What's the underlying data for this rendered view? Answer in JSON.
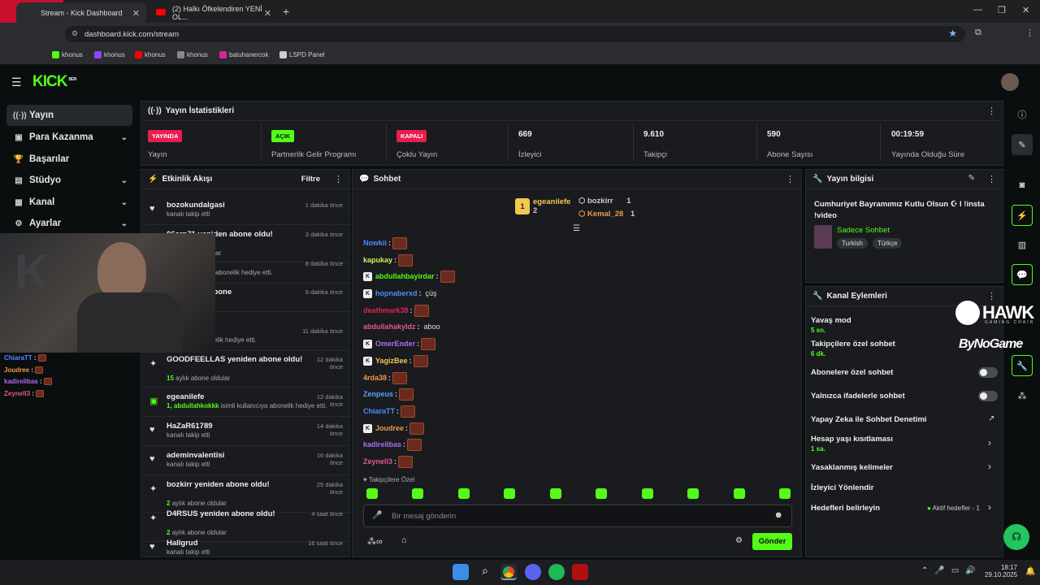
{
  "browser": {
    "tabs": [
      {
        "label": "Stream - Kick Dashboard",
        "active": true
      },
      {
        "label": "(2) Halkı Öfkelendiren YENİ OL...",
        "active": false
      }
    ],
    "url": "dashboard.kick.com/stream",
    "bookmarks": [
      "khonus",
      "khonus",
      "khonus",
      "khonus",
      "batuhanercok",
      "LSPD Panel"
    ]
  },
  "app": {
    "logo": "KICK",
    "logo_tag": "BETA"
  },
  "sidebar": {
    "items": [
      {
        "label": "Yayın",
        "icon": "broadcast-icon",
        "active": true
      },
      {
        "label": "Para Kazanma",
        "icon": "money-icon",
        "chev": true
      },
      {
        "label": "Başarılar",
        "icon": "trophy-icon"
      },
      {
        "label": "Stüdyo",
        "icon": "studio-icon",
        "chev": true
      },
      {
        "label": "Kanal",
        "icon": "channel-icon",
        "chev": true
      },
      {
        "label": "Ayarlar",
        "icon": "gear-icon",
        "chev": true
      }
    ]
  },
  "stats": {
    "title": "Yayın İstatistikleri",
    "items": [
      {
        "badge": "YAYINDA",
        "badge_color": "#e91e4e",
        "label": "Yayın"
      },
      {
        "badge": "AÇIK",
        "badge_color": "#53fc18",
        "label": "Partnerlik Gelir Programı"
      },
      {
        "badge": "KAPALI",
        "badge_color": "#e91e4e",
        "label": "Çoklu Yayın"
      },
      {
        "value": "669",
        "label": "İzleyici"
      },
      {
        "value": "9.610",
        "label": "Takipçi"
      },
      {
        "value": "590",
        "label": "Abone Sayısı"
      },
      {
        "value": "00:19:59",
        "label": "Yayında Olduğu Süre"
      }
    ]
  },
  "activity": {
    "title": "Etkinlik Akışı",
    "filter": "Filtre",
    "events": [
      {
        "name": "bozokundalgasi",
        "sub": "kanalı takip etti",
        "time": "1 dakika önce",
        "icon": "heart-icon"
      },
      {
        "name": "06ern71 yeniden abone oldu!",
        "sub": "aylık abone oldular",
        "time": "3 dakika önce",
        "icon": "sparkle-icon"
      },
      {
        "name": "",
        "sub": "isimli kullanıcıya abonelik hediye etti.",
        "time": "8 dakika önce",
        "icon": "gift-icon"
      },
      {
        "name": "da yeniden abone",
        "sub": "oldular",
        "time": "9 dakika önce",
        "icon": "sparkle-icon"
      },
      {
        "name": "",
        "sub": "kullanıcıya abonelik hediye etti.",
        "time": "11 dakika önce",
        "icon": "gift-icon"
      },
      {
        "name": "GOODFEELLAS yeniden abone oldu!",
        "sub_num": "15",
        "sub": "aylık abone oldular",
        "time": "12 dakika önce",
        "icon": "sparkle-icon"
      },
      {
        "name": "egeanilefe",
        "sub_num": "1, abdullahkokkk",
        "sub": "isimli kullanıcıya abonelik hediye etti.",
        "time": "12 dakika önce",
        "icon": "gift-icon"
      },
      {
        "name": "HaZaR61789",
        "sub": "kanalı takip etti",
        "time": "14 dakika önce",
        "icon": "heart-icon"
      },
      {
        "name": "ademinvalentisi",
        "sub": "kanalı takip etti",
        "time": "16 dakika önce",
        "icon": "heart-icon"
      },
      {
        "name": "bozkirr yeniden abone oldu!",
        "sub_num": "2",
        "sub": "aylık abone oldular",
        "time": "25 dakika önce",
        "icon": "sparkle-icon"
      },
      {
        "name": "D4RSUS yeniden abone oldu!",
        "sub_num": "2",
        "sub": "aylık abone oldular",
        "time": "4 saat önce",
        "icon": "sparkle-icon"
      },
      {
        "name": "Hallgrud",
        "sub": "kanalı takip etti",
        "time": "16 saat önce",
        "icon": "heart-icon"
      }
    ]
  },
  "chat": {
    "title": "Sohbet",
    "leaders": [
      {
        "name": "egeanilefe",
        "count": "2"
      },
      {
        "name": "bozkirr",
        "count": "1"
      },
      {
        "name": "Kemal_28",
        "count": "1"
      }
    ],
    "messages": [
      {
        "user": "Nowkii",
        "color": "#4e8cff",
        "text": ""
      },
      {
        "user": "kapukay",
        "color": "#c8f55a",
        "text": ""
      },
      {
        "user": "abdullahbayirdar",
        "color": "#53fc18",
        "text": ""
      },
      {
        "user": "hopnaberxd",
        "color": "#4e8cff",
        "text": "çüş"
      },
      {
        "user": "deathmark38",
        "color": "#e0234e",
        "text": ""
      },
      {
        "user": "abdullahakyldz",
        "color": "#e05a8a",
        "text": "aboo"
      },
      {
        "user": "OmerEnder",
        "color": "#b06cf5",
        "text": ""
      },
      {
        "user": "YagizBee",
        "color": "#f2c94c",
        "text": ""
      },
      {
        "user": "4rda38",
        "color": "#f2994a",
        "text": ""
      },
      {
        "user": "Zenpeus",
        "color": "#5aa0ff",
        "text": ""
      },
      {
        "user": "ChiaraTT",
        "color": "#4e8cff",
        "text": ""
      },
      {
        "user": "Joudree",
        "color": "#f2994a",
        "text": ""
      },
      {
        "user": "kadirelibas",
        "color": "#b06cf5",
        "text": ""
      },
      {
        "user": "Zeynell3",
        "color": "#e05a8a",
        "text": ""
      }
    ],
    "follower_only": "Takipçilere Özel",
    "placeholder": "Bir mesaj gönderin",
    "send": "Gönder"
  },
  "stream_info": {
    "title": "Yayın bilgisi",
    "stream_title": "Cumhuriyet Bayramımız Kutlu Olsun ☪ I !insta !video",
    "category": "Sadece Sohbet",
    "tags": [
      "Turkish",
      "Türkçe"
    ]
  },
  "channel_actions": {
    "title": "Kanal Eylemleri",
    "items": [
      {
        "label": "Yavaş mod",
        "sub": "5 sn."
      },
      {
        "label": "Takipçilere özel sohbet",
        "sub": "6 dk."
      },
      {
        "label": "Abonelere özel sohbet",
        "toggle": true
      },
      {
        "label": "Yalnızca ifadelerle sohbet",
        "toggle": true
      },
      {
        "label": "Yapay Zeka ile Sohbet Denetimi"
      },
      {
        "label": "Hesap yaşı kısıtlaması",
        "sub": "1 sa."
      },
      {
        "label": "Yasaklanmış kelimeler"
      },
      {
        "label": "İzleyici Yönlendir"
      },
      {
        "label": "Hedefleri belirleyin",
        "extra": "Aktif hedefler - 1"
      }
    ]
  },
  "overlay": {
    "brand1": "HAWK",
    "brand1_sub": "GAMING CHAIR",
    "brand2": "ByNoGame",
    "chat": [
      {
        "user": "ChiaraTT",
        "color": "#4e8cff"
      },
      {
        "user": "Joudree",
        "color": "#f2994a"
      },
      {
        "user": "kadirelibas",
        "color": "#b06cf5"
      },
      {
        "user": "Zeynell3",
        "color": "#e05a8a"
      }
    ]
  },
  "taskbar": {
    "time": "18:17",
    "date": "29.10.2025"
  }
}
